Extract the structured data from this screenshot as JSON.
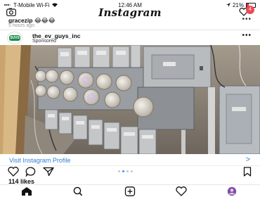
{
  "status_bar": {
    "carrier": "T-Mobile Wi-Fi",
    "time": "12:46 AM",
    "battery_percent": "21%",
    "battery_level": 0.21
  },
  "header": {
    "logo": "Instagram",
    "notification_count": "4"
  },
  "previous_post": {
    "username": "gracezip",
    "emoji": "😂😂😂",
    "time_ago": "5 hours ago"
  },
  "post": {
    "avatar_text": "SUVS",
    "username": "the_ev_guys_inc",
    "label": "Sponsored",
    "cta": "Visit Instagram Profile",
    "cta_arrow": ">",
    "likes": "114 likes",
    "carousel_pages": 4,
    "carousel_active": 1
  },
  "colors": {
    "accent": "#2f80d8",
    "badge": "#ed4956",
    "carousel_active": "#3897f0"
  },
  "icons": [
    "camera-icon",
    "heart-icon",
    "ellipsis-icon",
    "comment-icon",
    "share-icon",
    "save-icon",
    "home-icon",
    "search-icon",
    "add-icon",
    "profile-icon"
  ]
}
